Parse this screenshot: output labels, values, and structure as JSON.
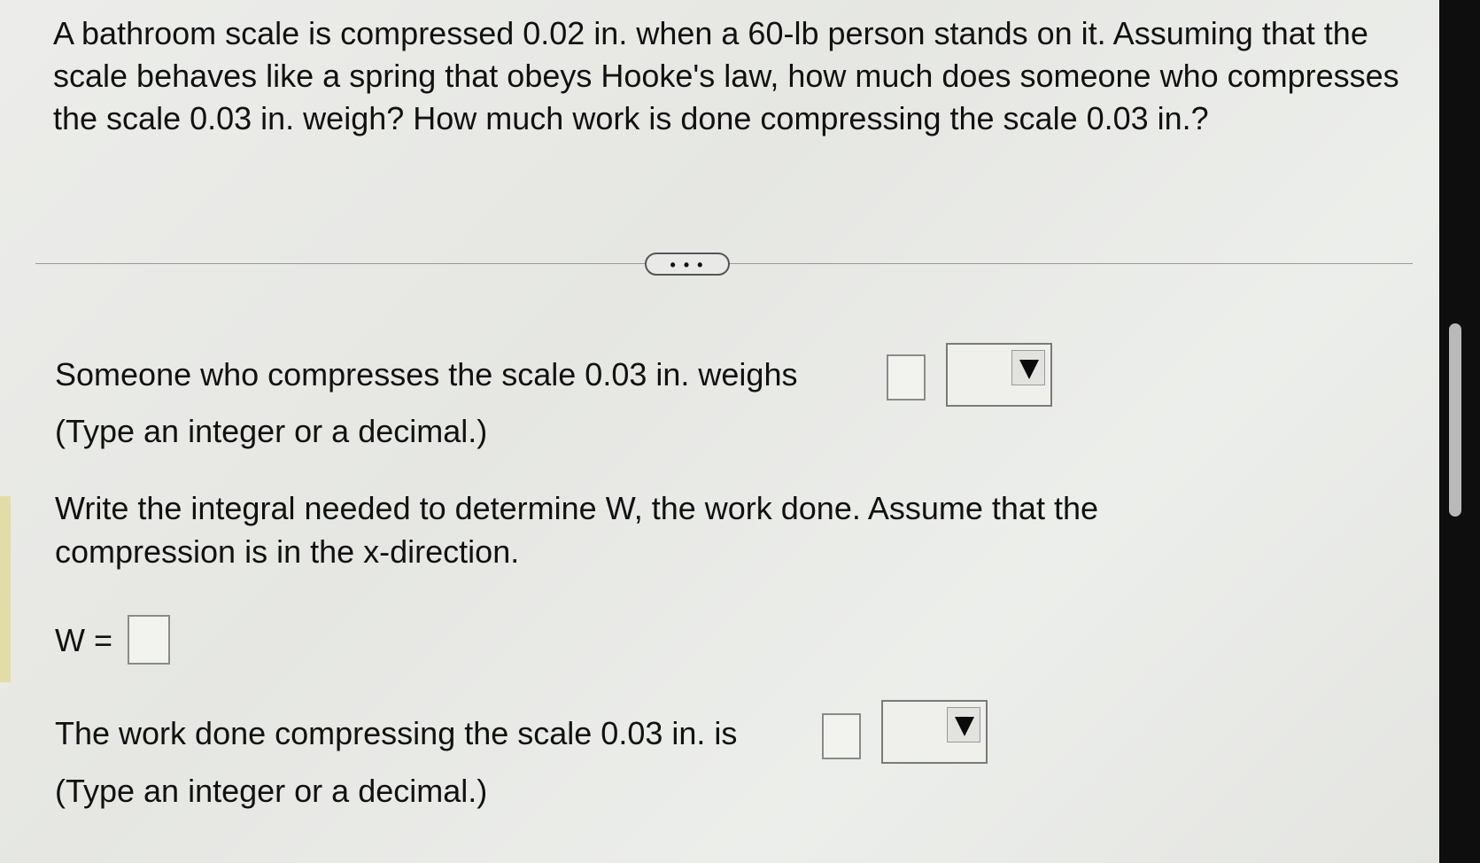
{
  "question": {
    "text": "A bathroom scale is compressed 0.02 in. when a 60-lb person stands on it. Assuming that the scale behaves like a spring that obeys Hooke's law, how much does someone who compresses the scale 0.03 in. weigh? How much work is done compressing the scale 0.03 in.?"
  },
  "more_button": {
    "label": "• • •"
  },
  "part1": {
    "prompt": "Someone who compresses the scale 0.03 in. weighs",
    "hint": "(Type an integer or a decimal.)",
    "input_value": "",
    "unit_selected": ""
  },
  "part2": {
    "prompt_line1": "Write the integral needed to determine W, the work done. Assume that the",
    "prompt_line2": "compression is in the x-direction.",
    "label": "W =",
    "input_value": ""
  },
  "part3": {
    "prompt": "The work done compressing the scale 0.03 in. is",
    "hint": "(Type an integer or a decimal.)",
    "input_value": "",
    "unit_selected": ""
  },
  "icons": {
    "dropdown_arrow": "triangle-down-icon"
  }
}
